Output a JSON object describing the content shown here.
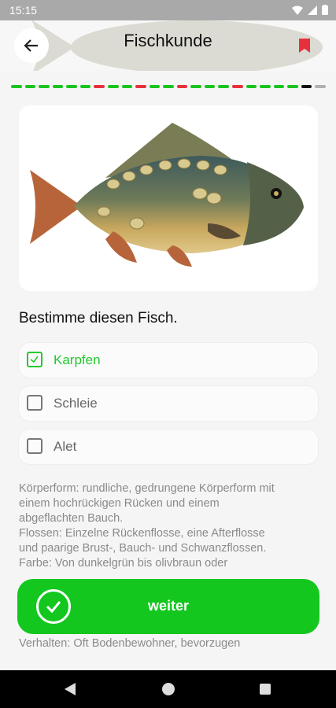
{
  "status": {
    "time": "15:15"
  },
  "header": {
    "title": "Fischkunde"
  },
  "progress": [
    "#19c41f",
    "#19c41f",
    "#19c41f",
    "#19c41f",
    "#19c41f",
    "#19c41f",
    "#e8303c",
    "#19c41f",
    "#19c41f",
    "#e8303c",
    "#19c41f",
    "#19c41f",
    "#e8303c",
    "#19c41f",
    "#19c41f",
    "#19c41f",
    "#e8303c",
    "#19c41f",
    "#19c41f",
    "#19c41f",
    "#19c41f",
    "#111111",
    "#b0b0b0"
  ],
  "question": "Bestimme diesen Fisch.",
  "options": [
    {
      "label": "Karpfen",
      "checked": true
    },
    {
      "label": "Schleie",
      "checked": false
    },
    {
      "label": "Alet",
      "checked": false
    }
  ],
  "description": {
    "lines": [
      "Körperform: rundliche, gedrungene Körperform mit",
      "einem hochrückigen Rücken und einem",
      "abgeflachten Bauch.",
      "Flossen: Einzelne Rückenflosse, eine Afterflosse",
      "und paarige Brust-, Bauch- und Schwanzflossen.",
      "Farbe: Von dunkelgrün bis olivbraun oder"
    ],
    "last_line": "Verhalten: Oft Bodenbewohner, bevorzugen"
  },
  "continue_button": {
    "label": "weiter"
  },
  "colors": {
    "accent": "#14c71f",
    "wrong": "#e8303c",
    "bookmark": "#e8303c"
  }
}
